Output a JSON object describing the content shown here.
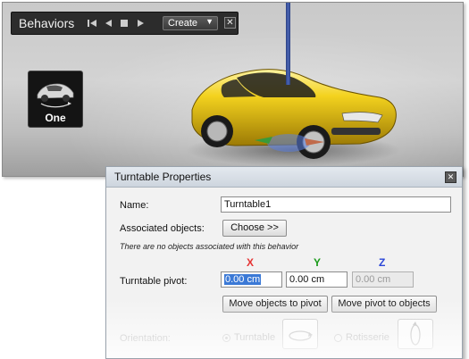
{
  "behaviors_panel": {
    "title": "Behaviors",
    "create_label": "Create",
    "close_glyph": "✕",
    "tile_label": "One",
    "transport_icons": [
      "skip-start-icon",
      "play-back-icon",
      "stop-icon",
      "play-icon"
    ]
  },
  "dialog": {
    "title": "Turntable Properties",
    "close_glyph": "✕",
    "name_label": "Name:",
    "name_value": "Turntable1",
    "assoc_label": "Associated objects:",
    "choose_label": "Choose >>",
    "note": "There are no objects associated with this behavior",
    "axes": {
      "x": "X",
      "y": "Y",
      "z": "Z"
    },
    "axis_colors": {
      "x": "#e53333",
      "y": "#1a9a1a",
      "z": "#2b46d8"
    },
    "pivot_label": "Turntable pivot:",
    "pivot_x": "0.00 cm",
    "pivot_y": "0.00 cm",
    "pivot_z": "0.00 cm",
    "move_objects_label": "Move objects to pivot",
    "move_pivot_label": "Move pivot to objects",
    "orientation_label": "Orientation:",
    "turntable_option": "Turntable",
    "rotisserie_option": "Rotisserie"
  }
}
